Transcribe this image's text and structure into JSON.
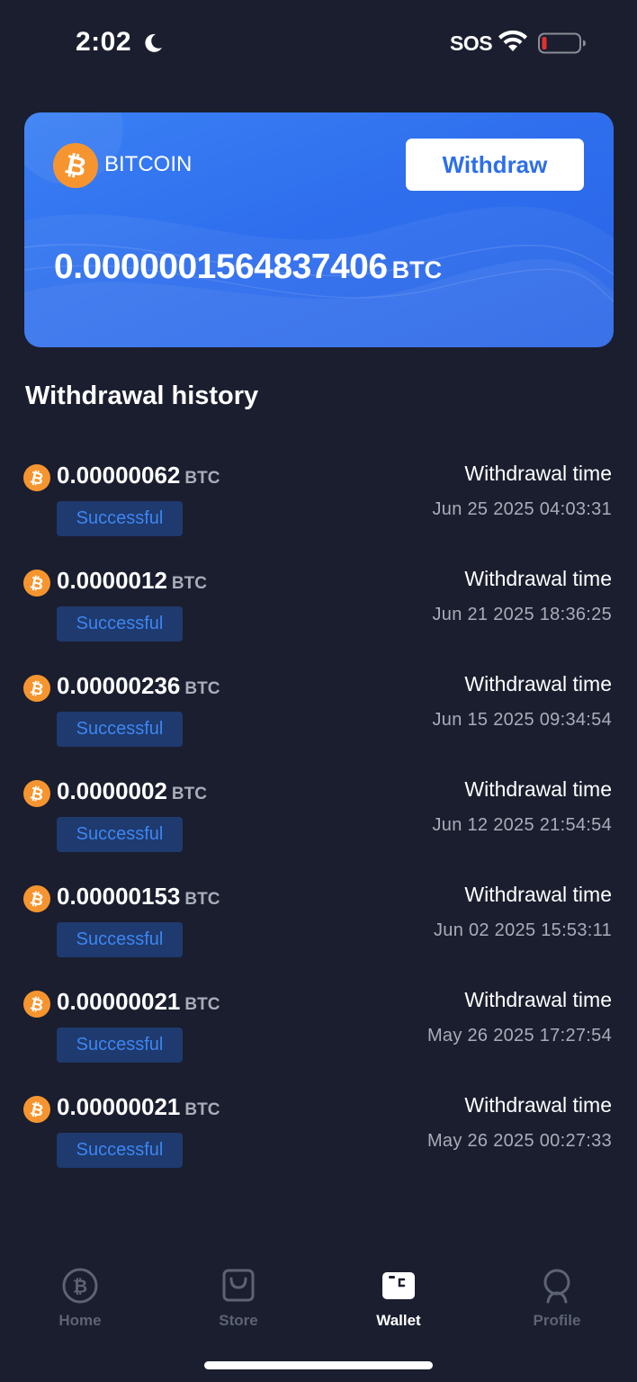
{
  "status_bar": {
    "time": "2:02",
    "sos": "SOS",
    "icons": [
      "moon-icon",
      "wifi-icon",
      "battery-low-icon"
    ],
    "battery_color": "#e3302f"
  },
  "card": {
    "coin_name": "BITCOIN",
    "withdraw_label": "Withdraw",
    "balance": "0.0000001564837406",
    "unit": "BTC",
    "colors": {
      "card": "#2f6fee",
      "button_text": "#2d6fe9",
      "coin": "#f6952f"
    }
  },
  "history": {
    "title": "Withdrawal history",
    "items": [
      {
        "amount": "0.00000062",
        "unit": "BTC",
        "status": "Successful",
        "time_label": "Withdrawal time",
        "time": "Jun 25 2025 04:03:31"
      },
      {
        "amount": "0.0000012",
        "unit": "BTC",
        "status": "Successful",
        "time_label": "Withdrawal time",
        "time": "Jun 21 2025 18:36:25"
      },
      {
        "amount": "0.00000236",
        "unit": "BTC",
        "status": "Successful",
        "time_label": "Withdrawal time",
        "time": "Jun 15 2025 09:34:54"
      },
      {
        "amount": "0.0000002",
        "unit": "BTC",
        "status": "Successful",
        "time_label": "Withdrawal time",
        "time": "Jun 12 2025 21:54:54"
      },
      {
        "amount": "0.00000153",
        "unit": "BTC",
        "status": "Successful",
        "time_label": "Withdrawal time",
        "time": "Jun 02 2025 15:53:11"
      },
      {
        "amount": "0.00000021",
        "unit": "BTC",
        "status": "Successful",
        "time_label": "Withdrawal time",
        "time": "May 26 2025 17:27:54"
      },
      {
        "amount": "0.00000021",
        "unit": "BTC",
        "status": "Successful",
        "time_label": "Withdrawal time",
        "time": "May 26 2025 00:27:33"
      }
    ]
  },
  "nav": {
    "items": [
      {
        "label": "Home",
        "icon": "bitcoin-icon",
        "active": false
      },
      {
        "label": "Store",
        "icon": "shopping-bag-icon",
        "active": false
      },
      {
        "label": "Wallet",
        "icon": "wallet-icon",
        "active": true
      },
      {
        "label": "Profile",
        "icon": "profile-icon",
        "active": false
      }
    ]
  }
}
